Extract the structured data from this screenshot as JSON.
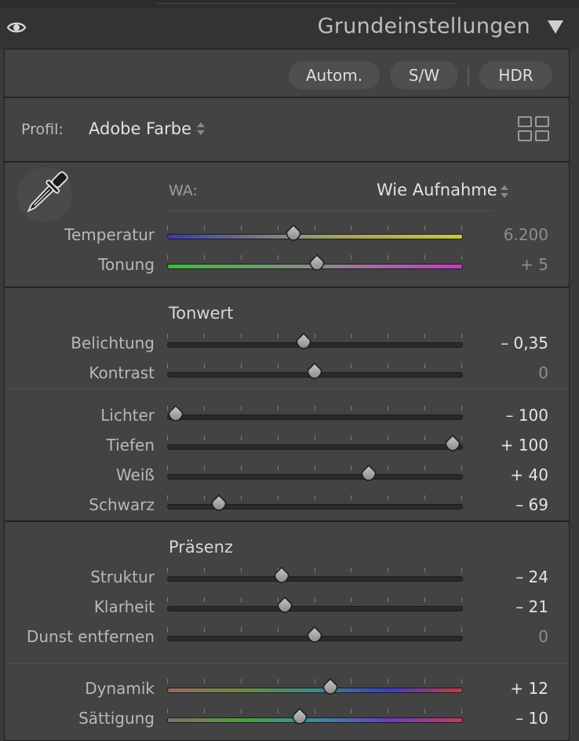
{
  "panel": {
    "title": "Grundeinstellungen"
  },
  "buttons": {
    "auto": "Autom.",
    "bw": "S/W",
    "hdr": "HDR"
  },
  "profile": {
    "label": "Profil:",
    "value": "Adobe Farbe"
  },
  "wb": {
    "label": "WA:",
    "value": "Wie Aufnahme"
  },
  "tonwert_title": "Tonwert",
  "praesenz_title": "Präsenz",
  "sliders": {
    "temperatur": {
      "label": "Temperatur",
      "value": "6.200",
      "position": 0.43,
      "track": "temp"
    },
    "tonung": {
      "label": "Tonung",
      "value": "+ 5",
      "position": 0.51,
      "track": "tint"
    },
    "belichtung": {
      "label": "Belichtung",
      "value": "– 0,35",
      "position": 0.465,
      "track": "dark"
    },
    "kontrast": {
      "label": "Kontrast",
      "value": "0",
      "position": 0.5,
      "track": "dark"
    },
    "lichter": {
      "label": "Lichter",
      "value": "– 100",
      "position": 0.03,
      "track": "dark"
    },
    "tiefen": {
      "label": "Tiefen",
      "value": "+ 100",
      "position": 0.97,
      "track": "dark"
    },
    "weiss": {
      "label": "Weiß",
      "value": "+ 40",
      "position": 0.685,
      "track": "dark"
    },
    "schwarz": {
      "label": "Schwarz",
      "value": "– 69",
      "position": 0.175,
      "track": "dark"
    },
    "struktur": {
      "label": "Struktur",
      "value": "– 24",
      "position": 0.39,
      "track": "dark"
    },
    "klarheit": {
      "label": "Klarheit",
      "value": "– 21",
      "position": 0.4,
      "track": "dark"
    },
    "dunst": {
      "label": "Dunst entfernen",
      "value": "0",
      "position": 0.5,
      "track": "dark"
    },
    "dynamik": {
      "label": "Dynamik",
      "value": "+ 12",
      "position": 0.555,
      "track": "vibrance"
    },
    "saettigung": {
      "label": "Sättigung",
      "value": "– 10",
      "position": 0.45,
      "track": "saturation"
    }
  },
  "colors": {
    "panel_bg": "#434343",
    "track_dark": "#2a2a2a",
    "temp_gradient": [
      "#3a3ab0",
      "#9a9a6a",
      "#c8c83c"
    ],
    "tint_gradient": [
      "#3cba3c",
      "#8a8a8a",
      "#c23cc2"
    ],
    "vibrance_gradient": [
      "#a06464",
      "#6a8a3c",
      "#3c8a8a",
      "#3c3cc2",
      "#c23c3c"
    ],
    "saturation_gradient": [
      "#8a6a6a",
      "#4aa03c",
      "#3c8aa0",
      "#6a3cc2",
      "#c23c5a"
    ]
  }
}
